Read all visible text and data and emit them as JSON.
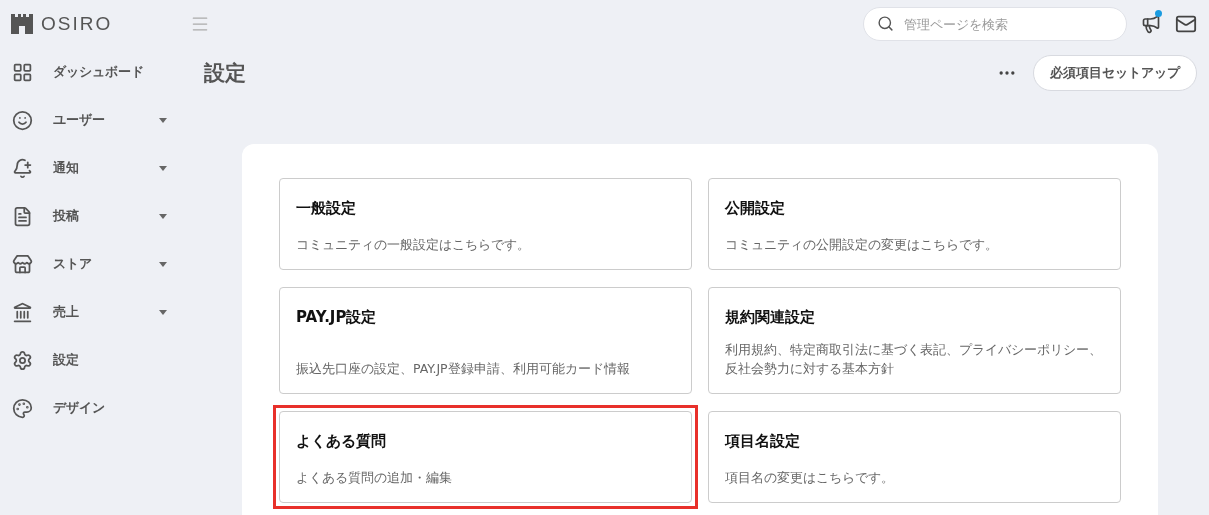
{
  "brand": {
    "name": "OSIRO"
  },
  "sidebar": {
    "items": [
      {
        "label": "ダッシュボード",
        "expandable": false
      },
      {
        "label": "ユーザー",
        "expandable": true
      },
      {
        "label": "通知",
        "expandable": true
      },
      {
        "label": "投稿",
        "expandable": true
      },
      {
        "label": "ストア",
        "expandable": true
      },
      {
        "label": "売上",
        "expandable": true
      },
      {
        "label": "設定",
        "expandable": false
      },
      {
        "label": "デザイン",
        "expandable": false
      }
    ]
  },
  "header": {
    "search": {
      "placeholder": "管理ページを検索"
    },
    "notification_dot": true
  },
  "page": {
    "title": "設定",
    "setup_button": "必須項目セットアップ"
  },
  "cards": [
    {
      "title": "一般設定",
      "description": "コミュニティの一般設定はこちらです。",
      "highlighted": false
    },
    {
      "title": "公開設定",
      "description": "コミュニティの公開設定の変更はこちらです。",
      "highlighted": false
    },
    {
      "title": "PAY.JP設定",
      "description": "振込先口座の設定、PAY.JP登録申請、利用可能カード情報",
      "highlighted": false
    },
    {
      "title": "規約関連設定",
      "description": "利用規約、特定商取引法に基づく表記、プライバシーポリシー、反社会勢力に対する基本方針",
      "highlighted": false
    },
    {
      "title": "よくある質問",
      "description": "よくある質問の追加・編集",
      "highlighted": true
    },
    {
      "title": "項目名設定",
      "description": "項目名の変更はこちらです。",
      "highlighted": false
    }
  ]
}
